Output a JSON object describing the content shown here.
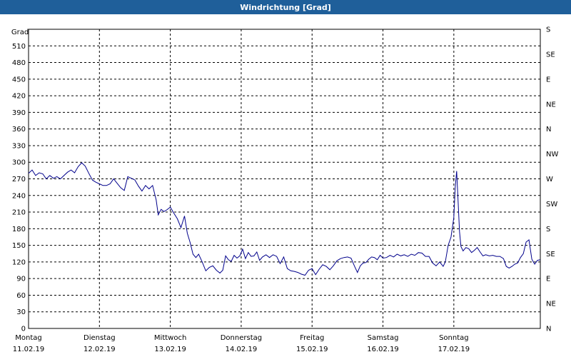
{
  "window": {
    "title": "Windrichtung [Grad]"
  },
  "chart_data": {
    "type": "line",
    "title": "Windrichtung [Grad]",
    "ylabel": "Grad",
    "ylim": [
      0,
      540
    ],
    "xlim": [
      0,
      7
    ],
    "grid": true,
    "colors": {
      "series": "#00008b",
      "grid": "#000000",
      "frame": "#000000"
    },
    "y_ticks": [
      0,
      30,
      60,
      90,
      120,
      150,
      180,
      210,
      240,
      270,
      300,
      330,
      360,
      390,
      420,
      450,
      480,
      510
    ],
    "y2_ticks": [
      {
        "value": 0,
        "label": "N"
      },
      {
        "value": 45,
        "label": "NE"
      },
      {
        "value": 90,
        "label": "E"
      },
      {
        "value": 135,
        "label": "SE"
      },
      {
        "value": 180,
        "label": "S"
      },
      {
        "value": 225,
        "label": "SW"
      },
      {
        "value": 270,
        "label": "W"
      },
      {
        "value": 315,
        "label": "NW"
      },
      {
        "value": 360,
        "label": "N"
      },
      {
        "value": 405,
        "label": "NE"
      },
      {
        "value": 450,
        "label": "E"
      },
      {
        "value": 495,
        "label": "SE"
      },
      {
        "value": 540,
        "label": "S"
      }
    ],
    "x_ticks": [
      {
        "value": 0,
        "day": "Montag",
        "date": "11.02.19"
      },
      {
        "value": 1,
        "day": "Dienstag",
        "date": "12.02.19"
      },
      {
        "value": 2,
        "day": "Mittwoch",
        "date": "13.02.19"
      },
      {
        "value": 3,
        "day": "Donnerstag",
        "date": "14.02.19"
      },
      {
        "value": 4,
        "day": "Freitag",
        "date": "15.02.19"
      },
      {
        "value": 5,
        "day": "Samstag",
        "date": "16.02.19"
      },
      {
        "value": 6,
        "day": "Sonntag",
        "date": "17.02.19"
      }
    ],
    "series": [
      {
        "points": [
          [
            0.0,
            280
          ],
          [
            0.05,
            286
          ],
          [
            0.1,
            276
          ],
          [
            0.15,
            281
          ],
          [
            0.2,
            279
          ],
          [
            0.25,
            270
          ],
          [
            0.3,
            276
          ],
          [
            0.35,
            271
          ],
          [
            0.4,
            274
          ],
          [
            0.45,
            270
          ],
          [
            0.5,
            276
          ],
          [
            0.55,
            282
          ],
          [
            0.6,
            286
          ],
          [
            0.65,
            281
          ],
          [
            0.7,
            292
          ],
          [
            0.75,
            299
          ],
          [
            0.8,
            293
          ],
          [
            0.85,
            280
          ],
          [
            0.9,
            268
          ],
          [
            0.95,
            264
          ],
          [
            1.0,
            261
          ],
          [
            1.05,
            258
          ],
          [
            1.1,
            258
          ],
          [
            1.15,
            261
          ],
          [
            1.2,
            270
          ],
          [
            1.25,
            262
          ],
          [
            1.3,
            254
          ],
          [
            1.35,
            249
          ],
          [
            1.4,
            274
          ],
          [
            1.45,
            271
          ],
          [
            1.5,
            268
          ],
          [
            1.55,
            257
          ],
          [
            1.6,
            248
          ],
          [
            1.65,
            258
          ],
          [
            1.7,
            252
          ],
          [
            1.75,
            258
          ],
          [
            1.8,
            232
          ],
          [
            1.83,
            205
          ],
          [
            1.87,
            215
          ],
          [
            1.91,
            211
          ],
          [
            1.95,
            214
          ],
          [
            2.0,
            219
          ],
          [
            2.05,
            208
          ],
          [
            2.1,
            198
          ],
          [
            2.15,
            182
          ],
          [
            2.2,
            203
          ],
          [
            2.24,
            172
          ],
          [
            2.28,
            155
          ],
          [
            2.32,
            134
          ],
          [
            2.36,
            128
          ],
          [
            2.4,
            134
          ],
          [
            2.45,
            120
          ],
          [
            2.5,
            104
          ],
          [
            2.55,
            110
          ],
          [
            2.6,
            113
          ],
          [
            2.65,
            105
          ],
          [
            2.7,
            100
          ],
          [
            2.74,
            105
          ],
          [
            2.78,
            131
          ],
          [
            2.82,
            124
          ],
          [
            2.86,
            121
          ],
          [
            2.9,
            132
          ],
          [
            2.94,
            127
          ],
          [
            2.98,
            131
          ],
          [
            3.02,
            143
          ],
          [
            3.06,
            126
          ],
          [
            3.1,
            137
          ],
          [
            3.14,
            130
          ],
          [
            3.18,
            131
          ],
          [
            3.22,
            138
          ],
          [
            3.26,
            123
          ],
          [
            3.3,
            129
          ],
          [
            3.35,
            133
          ],
          [
            3.4,
            128
          ],
          [
            3.45,
            133
          ],
          [
            3.5,
            130
          ],
          [
            3.55,
            117
          ],
          [
            3.6,
            129
          ],
          [
            3.65,
            108
          ],
          [
            3.7,
            104
          ],
          [
            3.75,
            103
          ],
          [
            3.8,
            101
          ],
          [
            3.85,
            98
          ],
          [
            3.9,
            96
          ],
          [
            3.95,
            105
          ],
          [
            4.0,
            108
          ],
          [
            4.05,
            97
          ],
          [
            4.1,
            107
          ],
          [
            4.15,
            115
          ],
          [
            4.2,
            112
          ],
          [
            4.25,
            106
          ],
          [
            4.3,
            113
          ],
          [
            4.35,
            122
          ],
          [
            4.4,
            126
          ],
          [
            4.45,
            128
          ],
          [
            4.5,
            129
          ],
          [
            4.55,
            127
          ],
          [
            4.6,
            112
          ],
          [
            4.64,
            101
          ],
          [
            4.68,
            113
          ],
          [
            4.72,
            118
          ],
          [
            4.76,
            119
          ],
          [
            4.8,
            125
          ],
          [
            4.84,
            129
          ],
          [
            4.88,
            128
          ],
          [
            4.92,
            124
          ],
          [
            4.96,
            132
          ],
          [
            5.0,
            127
          ],
          [
            5.05,
            128
          ],
          [
            5.1,
            132
          ],
          [
            5.15,
            129
          ],
          [
            5.2,
            134
          ],
          [
            5.25,
            131
          ],
          [
            5.3,
            133
          ],
          [
            5.35,
            130
          ],
          [
            5.4,
            134
          ],
          [
            5.45,
            132
          ],
          [
            5.5,
            137
          ],
          [
            5.55,
            136
          ],
          [
            5.6,
            130
          ],
          [
            5.65,
            130
          ],
          [
            5.7,
            118
          ],
          [
            5.75,
            113
          ],
          [
            5.8,
            120
          ],
          [
            5.85,
            112
          ],
          [
            5.88,
            120
          ],
          [
            5.92,
            150
          ],
          [
            5.96,
            165
          ],
          [
            6.0,
            200
          ],
          [
            6.02,
            255
          ],
          [
            6.04,
            284
          ],
          [
            6.06,
            230
          ],
          [
            6.08,
            175
          ],
          [
            6.1,
            148
          ],
          [
            6.13,
            140
          ],
          [
            6.17,
            146
          ],
          [
            6.21,
            144
          ],
          [
            6.25,
            137
          ],
          [
            6.29,
            141
          ],
          [
            6.33,
            146
          ],
          [
            6.37,
            138
          ],
          [
            6.41,
            131
          ],
          [
            6.45,
            133
          ],
          [
            6.5,
            131
          ],
          [
            6.55,
            132
          ],
          [
            6.6,
            130
          ],
          [
            6.65,
            130
          ],
          [
            6.7,
            126
          ],
          [
            6.74,
            112
          ],
          [
            6.78,
            109
          ],
          [
            6.82,
            112
          ],
          [
            6.86,
            116
          ],
          [
            6.9,
            118
          ],
          [
            6.94,
            128
          ],
          [
            6.98,
            135
          ],
          [
            7.02,
            156
          ],
          [
            7.06,
            160
          ],
          [
            7.1,
            125
          ],
          [
            7.14,
            116
          ],
          [
            7.18,
            123
          ],
          [
            7.22,
            124
          ]
        ]
      }
    ]
  }
}
